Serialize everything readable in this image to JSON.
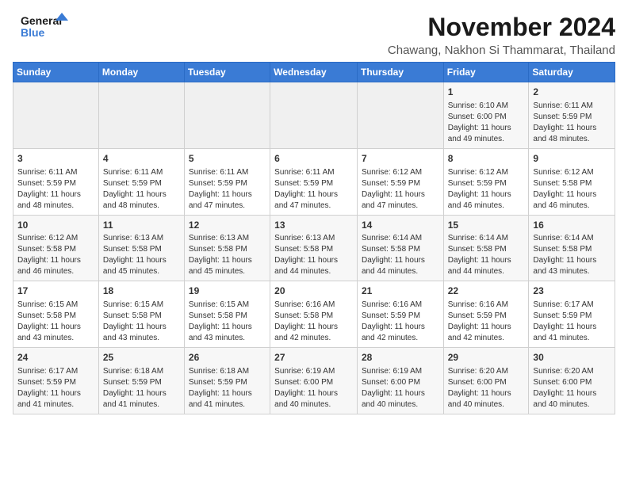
{
  "logo": {
    "line1": "General",
    "line2": "Blue"
  },
  "title": "November 2024",
  "location": "Chawang, Nakhon Si Thammarat, Thailand",
  "days_of_week": [
    "Sunday",
    "Monday",
    "Tuesday",
    "Wednesday",
    "Thursday",
    "Friday",
    "Saturday"
  ],
  "weeks": [
    [
      {
        "day": "",
        "empty": true
      },
      {
        "day": "",
        "empty": true
      },
      {
        "day": "",
        "empty": true
      },
      {
        "day": "",
        "empty": true
      },
      {
        "day": "",
        "empty": true
      },
      {
        "day": "1",
        "sunrise": "6:10 AM",
        "sunset": "6:00 PM",
        "daylight": "11 hours and 49 minutes."
      },
      {
        "day": "2",
        "sunrise": "6:11 AM",
        "sunset": "5:59 PM",
        "daylight": "11 hours and 48 minutes."
      }
    ],
    [
      {
        "day": "3",
        "sunrise": "6:11 AM",
        "sunset": "5:59 PM",
        "daylight": "11 hours and 48 minutes."
      },
      {
        "day": "4",
        "sunrise": "6:11 AM",
        "sunset": "5:59 PM",
        "daylight": "11 hours and 48 minutes."
      },
      {
        "day": "5",
        "sunrise": "6:11 AM",
        "sunset": "5:59 PM",
        "daylight": "11 hours and 47 minutes."
      },
      {
        "day": "6",
        "sunrise": "6:11 AM",
        "sunset": "5:59 PM",
        "daylight": "11 hours and 47 minutes."
      },
      {
        "day": "7",
        "sunrise": "6:12 AM",
        "sunset": "5:59 PM",
        "daylight": "11 hours and 47 minutes."
      },
      {
        "day": "8",
        "sunrise": "6:12 AM",
        "sunset": "5:59 PM",
        "daylight": "11 hours and 46 minutes."
      },
      {
        "day": "9",
        "sunrise": "6:12 AM",
        "sunset": "5:58 PM",
        "daylight": "11 hours and 46 minutes."
      }
    ],
    [
      {
        "day": "10",
        "sunrise": "6:12 AM",
        "sunset": "5:58 PM",
        "daylight": "11 hours and 46 minutes."
      },
      {
        "day": "11",
        "sunrise": "6:13 AM",
        "sunset": "5:58 PM",
        "daylight": "11 hours and 45 minutes."
      },
      {
        "day": "12",
        "sunrise": "6:13 AM",
        "sunset": "5:58 PM",
        "daylight": "11 hours and 45 minutes."
      },
      {
        "day": "13",
        "sunrise": "6:13 AM",
        "sunset": "5:58 PM",
        "daylight": "11 hours and 44 minutes."
      },
      {
        "day": "14",
        "sunrise": "6:14 AM",
        "sunset": "5:58 PM",
        "daylight": "11 hours and 44 minutes."
      },
      {
        "day": "15",
        "sunrise": "6:14 AM",
        "sunset": "5:58 PM",
        "daylight": "11 hours and 44 minutes."
      },
      {
        "day": "16",
        "sunrise": "6:14 AM",
        "sunset": "5:58 PM",
        "daylight": "11 hours and 43 minutes."
      }
    ],
    [
      {
        "day": "17",
        "sunrise": "6:15 AM",
        "sunset": "5:58 PM",
        "daylight": "11 hours and 43 minutes."
      },
      {
        "day": "18",
        "sunrise": "6:15 AM",
        "sunset": "5:58 PM",
        "daylight": "11 hours and 43 minutes."
      },
      {
        "day": "19",
        "sunrise": "6:15 AM",
        "sunset": "5:58 PM",
        "daylight": "11 hours and 43 minutes."
      },
      {
        "day": "20",
        "sunrise": "6:16 AM",
        "sunset": "5:58 PM",
        "daylight": "11 hours and 42 minutes."
      },
      {
        "day": "21",
        "sunrise": "6:16 AM",
        "sunset": "5:59 PM",
        "daylight": "11 hours and 42 minutes."
      },
      {
        "day": "22",
        "sunrise": "6:16 AM",
        "sunset": "5:59 PM",
        "daylight": "11 hours and 42 minutes."
      },
      {
        "day": "23",
        "sunrise": "6:17 AM",
        "sunset": "5:59 PM",
        "daylight": "11 hours and 41 minutes."
      }
    ],
    [
      {
        "day": "24",
        "sunrise": "6:17 AM",
        "sunset": "5:59 PM",
        "daylight": "11 hours and 41 minutes."
      },
      {
        "day": "25",
        "sunrise": "6:18 AM",
        "sunset": "5:59 PM",
        "daylight": "11 hours and 41 minutes."
      },
      {
        "day": "26",
        "sunrise": "6:18 AM",
        "sunset": "5:59 PM",
        "daylight": "11 hours and 41 minutes."
      },
      {
        "day": "27",
        "sunrise": "6:19 AM",
        "sunset": "6:00 PM",
        "daylight": "11 hours and 40 minutes."
      },
      {
        "day": "28",
        "sunrise": "6:19 AM",
        "sunset": "6:00 PM",
        "daylight": "11 hours and 40 minutes."
      },
      {
        "day": "29",
        "sunrise": "6:20 AM",
        "sunset": "6:00 PM",
        "daylight": "11 hours and 40 minutes."
      },
      {
        "day": "30",
        "sunrise": "6:20 AM",
        "sunset": "6:00 PM",
        "daylight": "11 hours and 40 minutes."
      }
    ]
  ],
  "labels": {
    "sunrise": "Sunrise:",
    "sunset": "Sunset:",
    "daylight": "Daylight:"
  }
}
